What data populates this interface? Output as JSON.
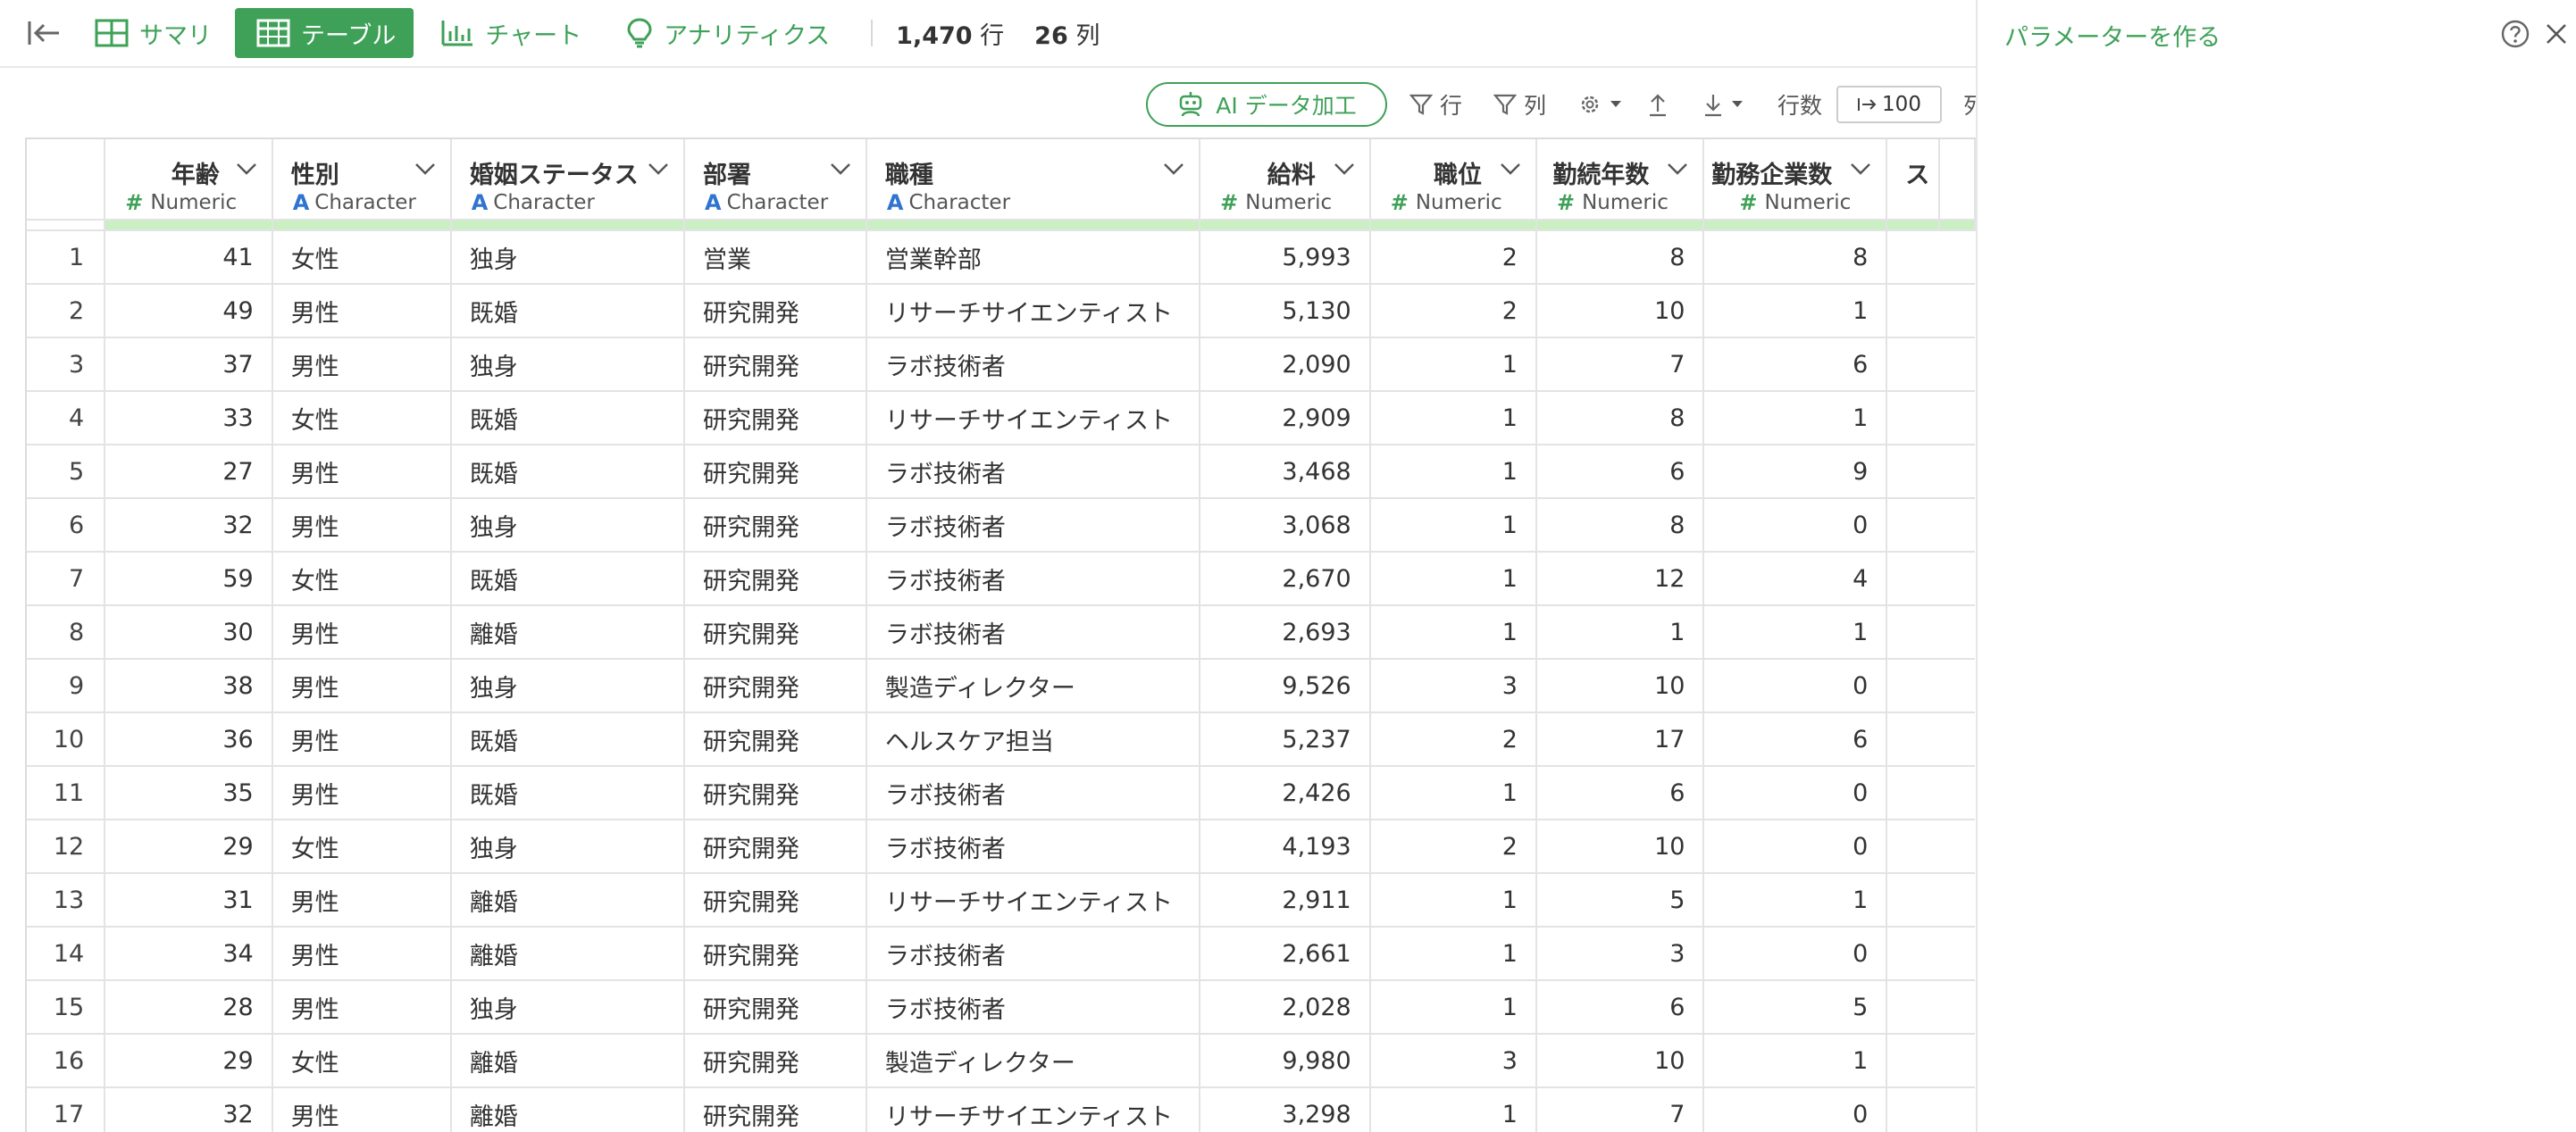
{
  "nav": {
    "tabs": [
      {
        "label": "サマリ",
        "icon": "summary-icon"
      },
      {
        "label": "テーブル",
        "icon": "table-icon",
        "active": true
      },
      {
        "label": "チャート",
        "icon": "chart-icon"
      },
      {
        "label": "アナリティクス",
        "icon": "lightbulb-icon"
      }
    ],
    "row_count": "1,470",
    "row_unit": "行",
    "col_count": "26",
    "col_unit": "列"
  },
  "toolbar": {
    "ai_label": "AI データ加工",
    "row_filter_label": "行",
    "col_filter_label": "列",
    "rows_label": "行数",
    "rows_value": "100",
    "cut_label": "列"
  },
  "panel": {
    "title": "パラメーターを作る"
  },
  "colors": {
    "accent": "#3ea157",
    "numeric_mark": "#3ea157",
    "character_mark": "#2f74d0",
    "quality_bar": "#c9efc3"
  },
  "table": {
    "columns": [
      {
        "name": "年齢",
        "type": "Numeric"
      },
      {
        "name": "性別",
        "type": "Character"
      },
      {
        "name": "婚姻ステータス",
        "type": "Character"
      },
      {
        "name": "部署",
        "type": "Character"
      },
      {
        "name": "職種",
        "type": "Character"
      },
      {
        "name": "給料",
        "type": "Numeric"
      },
      {
        "name": "職位",
        "type": "Numeric"
      },
      {
        "name": "勤続年数",
        "type": "Numeric"
      },
      {
        "name": "勤務企業数",
        "type": "Numeric"
      },
      {
        "name": "ス",
        "type": ""
      }
    ],
    "rows": [
      [
        "1",
        "41",
        "女性",
        "独身",
        "営業",
        "営業幹部",
        "5,993",
        "2",
        "8",
        "8"
      ],
      [
        "2",
        "49",
        "男性",
        "既婚",
        "研究開発",
        "リサーチサイエンティスト",
        "5,130",
        "2",
        "10",
        "1"
      ],
      [
        "3",
        "37",
        "男性",
        "独身",
        "研究開発",
        "ラボ技術者",
        "2,090",
        "1",
        "7",
        "6"
      ],
      [
        "4",
        "33",
        "女性",
        "既婚",
        "研究開発",
        "リサーチサイエンティスト",
        "2,909",
        "1",
        "8",
        "1"
      ],
      [
        "5",
        "27",
        "男性",
        "既婚",
        "研究開発",
        "ラボ技術者",
        "3,468",
        "1",
        "6",
        "9"
      ],
      [
        "6",
        "32",
        "男性",
        "独身",
        "研究開発",
        "ラボ技術者",
        "3,068",
        "1",
        "8",
        "0"
      ],
      [
        "7",
        "59",
        "女性",
        "既婚",
        "研究開発",
        "ラボ技術者",
        "2,670",
        "1",
        "12",
        "4"
      ],
      [
        "8",
        "30",
        "男性",
        "離婚",
        "研究開発",
        "ラボ技術者",
        "2,693",
        "1",
        "1",
        "1"
      ],
      [
        "9",
        "38",
        "男性",
        "独身",
        "研究開発",
        "製造ディレクター",
        "9,526",
        "3",
        "10",
        "0"
      ],
      [
        "10",
        "36",
        "男性",
        "既婚",
        "研究開発",
        "ヘルスケア担当",
        "5,237",
        "2",
        "17",
        "6"
      ],
      [
        "11",
        "35",
        "男性",
        "既婚",
        "研究開発",
        "ラボ技術者",
        "2,426",
        "1",
        "6",
        "0"
      ],
      [
        "12",
        "29",
        "女性",
        "独身",
        "研究開発",
        "ラボ技術者",
        "4,193",
        "2",
        "10",
        "0"
      ],
      [
        "13",
        "31",
        "男性",
        "離婚",
        "研究開発",
        "リサーチサイエンティスト",
        "2,911",
        "1",
        "5",
        "1"
      ],
      [
        "14",
        "34",
        "男性",
        "離婚",
        "研究開発",
        "ラボ技術者",
        "2,661",
        "1",
        "3",
        "0"
      ],
      [
        "15",
        "28",
        "男性",
        "独身",
        "研究開発",
        "ラボ技術者",
        "2,028",
        "1",
        "6",
        "5"
      ],
      [
        "16",
        "29",
        "女性",
        "離婚",
        "研究開発",
        "製造ディレクター",
        "9,980",
        "3",
        "10",
        "1"
      ],
      [
        "17",
        "32",
        "男性",
        "離婚",
        "研究開発",
        "リサーチサイエンティスト",
        "3,298",
        "1",
        "7",
        "0"
      ]
    ]
  }
}
